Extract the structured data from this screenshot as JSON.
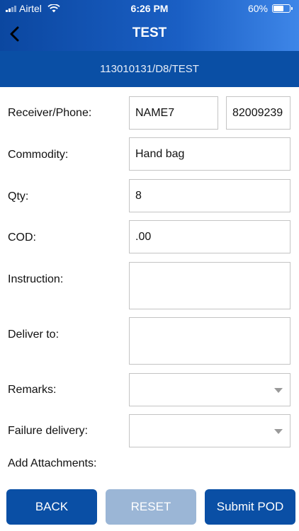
{
  "status_bar": {
    "carrier": "Airtel",
    "time": "6:26 PM",
    "battery": "60%",
    "battery_level": 0.6
  },
  "nav": {
    "title": "TEST"
  },
  "subheader": {
    "text": "113010131/D8/TEST"
  },
  "form": {
    "receiver_label": "Receiver/Phone:",
    "receiver_name": "NAME7",
    "receiver_phone": "82009239",
    "commodity_label": "Commodity:",
    "commodity_value": "Hand bag",
    "qty_label": "Qty:",
    "qty_value": "8",
    "cod_label": "COD:",
    "cod_value": ".00",
    "instruction_label": "Instruction:",
    "instruction_value": "",
    "deliver_to_label": "Deliver to:",
    "deliver_to_value": "",
    "remarks_label": "Remarks:",
    "remarks_value": "",
    "failure_label": "Failure delivery:",
    "failure_value": "",
    "attachments_label": "Add Attachments:"
  },
  "buttons": {
    "back": "BACK",
    "reset": "RESET",
    "submit": "Submit POD"
  },
  "colors": {
    "primary": "#0a4fa5",
    "disabled": "#9bb6d6",
    "header_gradient_end": "#3e86e8"
  }
}
